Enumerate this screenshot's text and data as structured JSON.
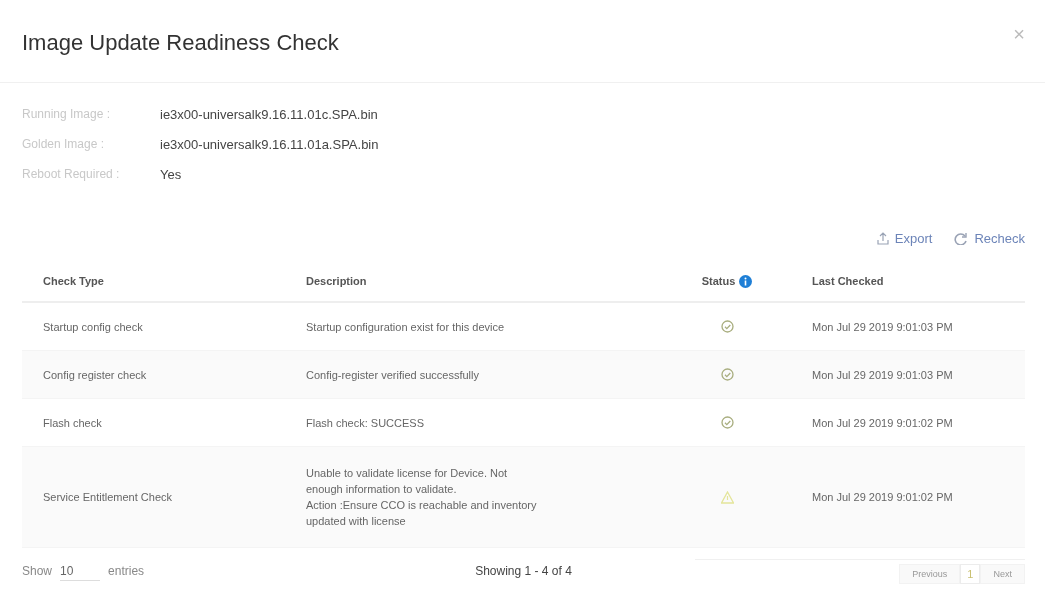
{
  "dialog": {
    "title": "Image Update Readiness Check",
    "close": "×"
  },
  "details": [
    {
      "label": "Running Image :",
      "value": "ie3x00-universalk9.16.11.01c.SPA.bin"
    },
    {
      "label": "Golden Image :",
      "value": "ie3x00-universalk9.16.11.01a.SPA.bin"
    },
    {
      "label": "Reboot Required :",
      "value": "Yes"
    }
  ],
  "actions": [
    "Export",
    "Recheck"
  ],
  "table": {
    "columns": [
      "Check Type",
      "Description",
      "Status",
      "Last Checked"
    ],
    "rows": [
      {
        "check_type": "Startup config check",
        "description": "Startup configuration exist for this device",
        "kind": "success",
        "last_checked": "Mon Jul 29 2019 9:01:03 PM"
      },
      {
        "check_type": "Config register check",
        "description": "Config-register verified successfully",
        "kind": "success",
        "last_checked": "Mon Jul 29 2019 9:01:03 PM"
      },
      {
        "check_type": "Flash check",
        "description": "Flash check: SUCCESS",
        "kind": "success",
        "last_checked": "Mon Jul 29 2019 9:01:02 PM"
      },
      {
        "check_type": "Service Entitlement Check",
        "description": "Unable to validate license for Device. Not enough information to validate.\nAction :Ensure CCO is reachable and inventory updated with license",
        "kind": "warning",
        "last_checked": "Mon Jul 29 2019 9:01:02 PM"
      }
    ]
  },
  "footer": {
    "show_label": "Show",
    "page_size": "10",
    "entries_label": "entries",
    "summary": "Showing 1 - 4 of 4",
    "pages": [
      {
        "label": "Previous",
        "kind": "nav",
        "disabled": true,
        "selected": false
      },
      {
        "label": "1",
        "kind": "page",
        "disabled": false,
        "selected": true
      },
      {
        "label": "Next",
        "kind": "nav",
        "disabled": true,
        "selected": false
      }
    ]
  }
}
